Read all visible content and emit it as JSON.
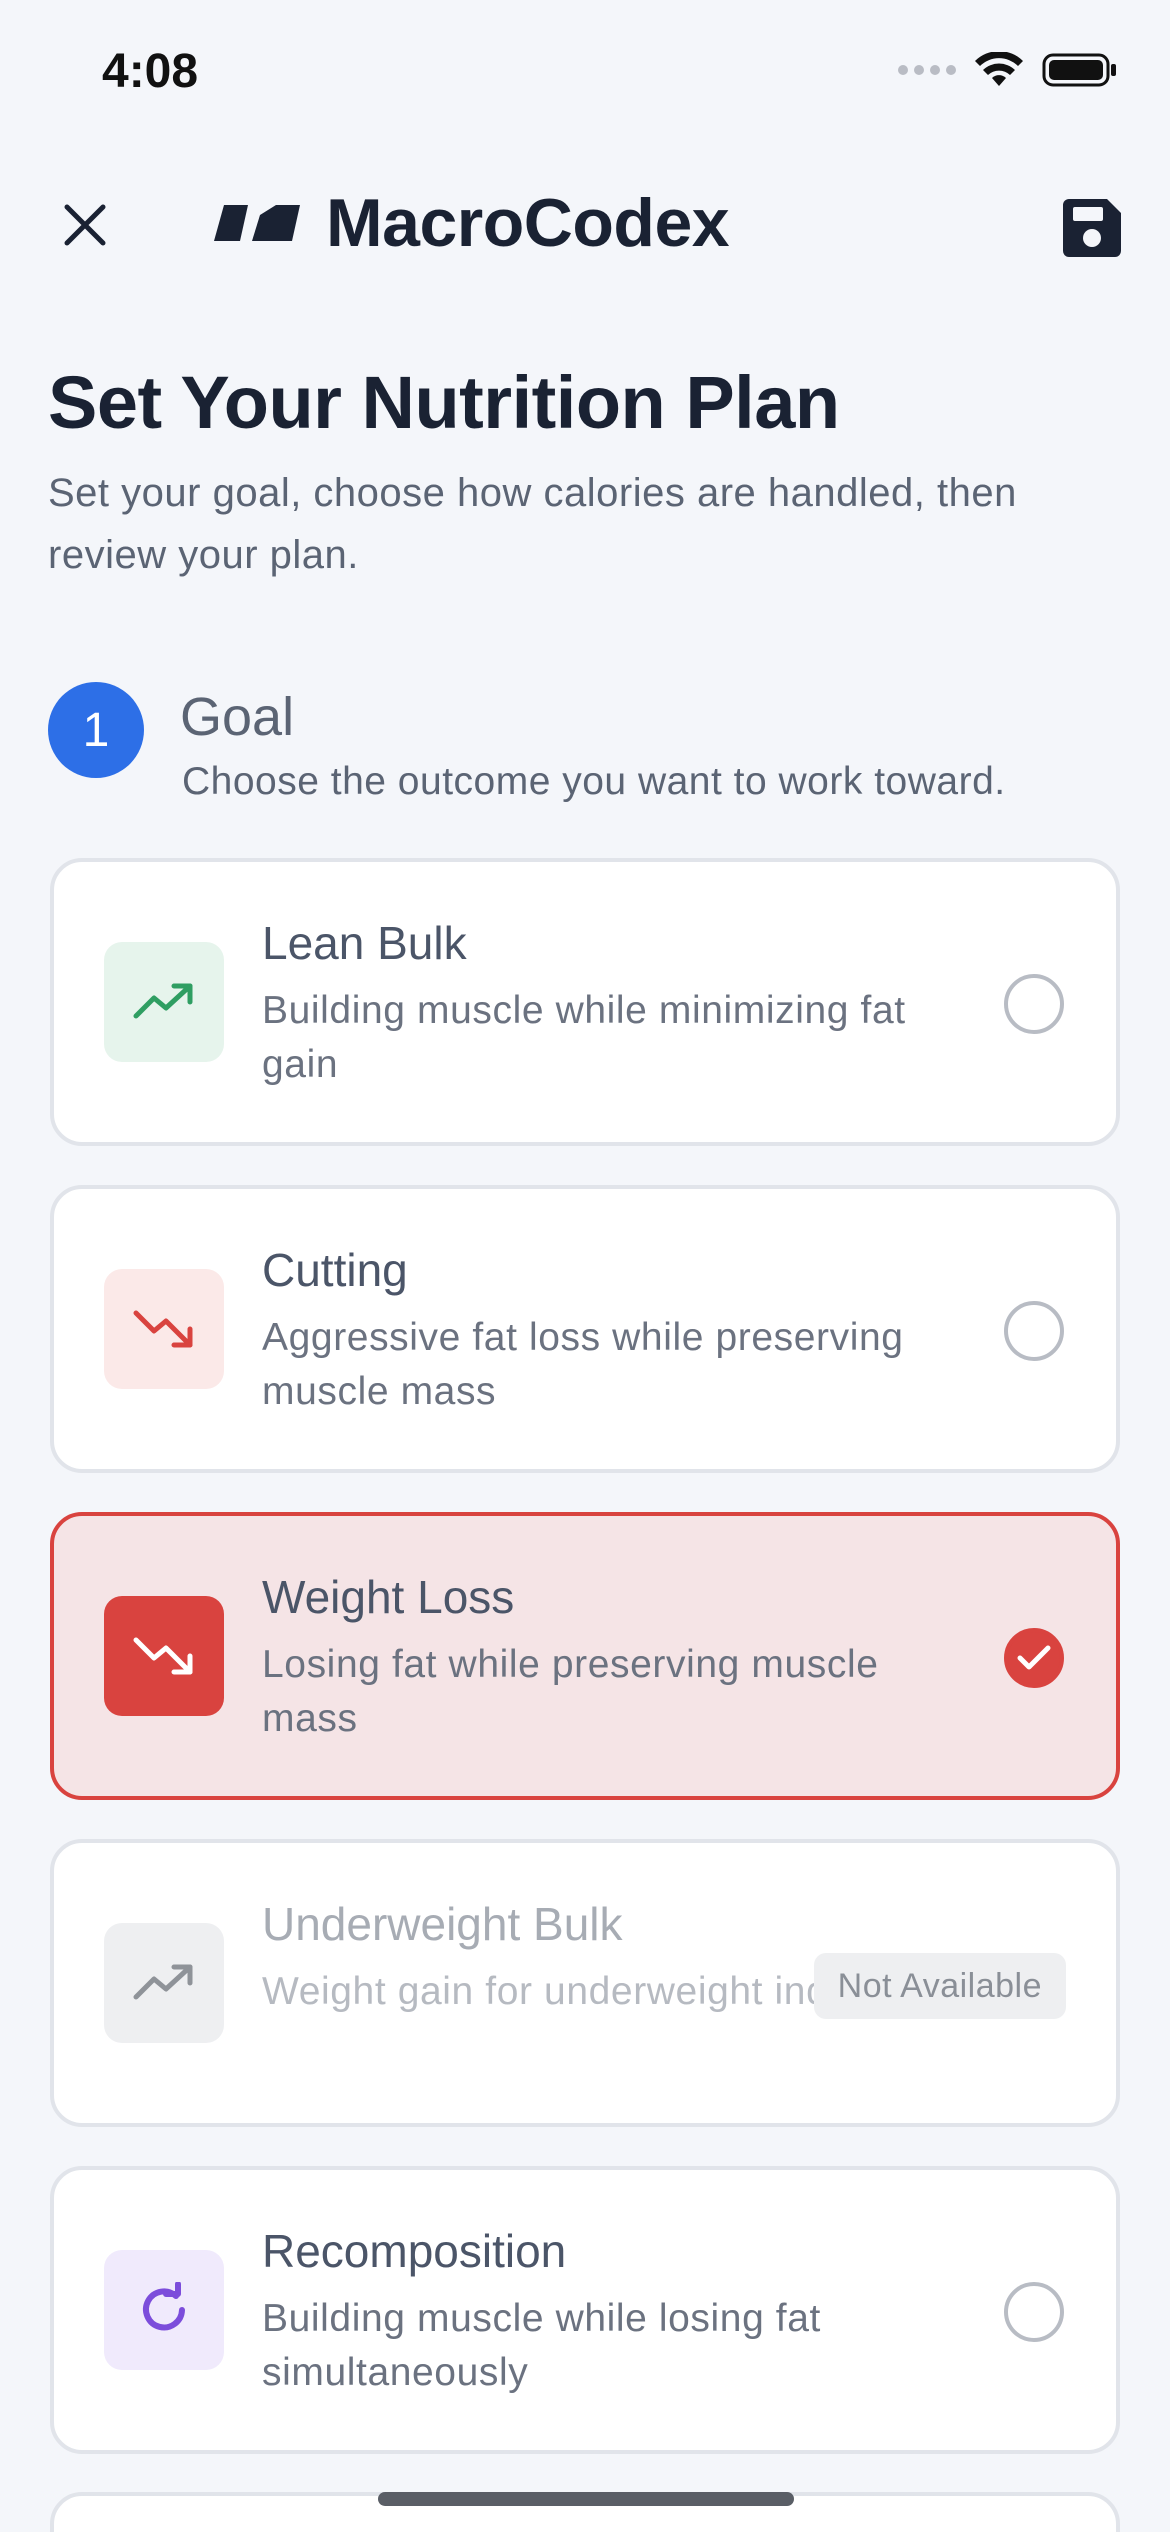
{
  "status_bar": {
    "time": "4:08"
  },
  "header": {
    "brand": "MacroCodex"
  },
  "page": {
    "title": "Set Your Nutrition Plan",
    "subtitle": "Set your goal, choose how calories are handled, then review your plan."
  },
  "step": {
    "number": "1",
    "title": "Goal",
    "description": "Choose the outcome you want to work toward."
  },
  "options": [
    {
      "title": "Lean Bulk",
      "description": "Building muscle while minimizing fat gain",
      "icon": "trending-up-icon",
      "icon_color": "#2f9e62",
      "icon_bg": "#e6f4ec",
      "state": "unselected"
    },
    {
      "title": "Cutting",
      "description": "Aggressive fat loss while preserving muscle mass",
      "icon": "trending-down-icon",
      "icon_color": "#d9433f",
      "icon_bg": "#fbe9e8",
      "state": "unselected"
    },
    {
      "title": "Weight Loss",
      "description": "Losing fat while preserving muscle mass",
      "icon": "trending-down-icon",
      "icon_color": "#ffffff",
      "icon_bg": "#d9433f",
      "state": "selected"
    },
    {
      "title": "Underweight Bulk",
      "description": "Weight gain for underweight individuals",
      "icon": "trending-up-icon",
      "icon_color": "#8f9399",
      "icon_bg": "#eeeff1",
      "state": "disabled",
      "badge": "Not Available"
    },
    {
      "title": "Recomposition",
      "description": "Building muscle while losing fat simultaneously",
      "icon": "refresh-icon",
      "icon_color": "#7c4ddb",
      "icon_bg": "#f0eafc",
      "state": "unselected"
    }
  ],
  "colors": {
    "accent": "#2d6fe7",
    "selected": "#d9433f"
  }
}
